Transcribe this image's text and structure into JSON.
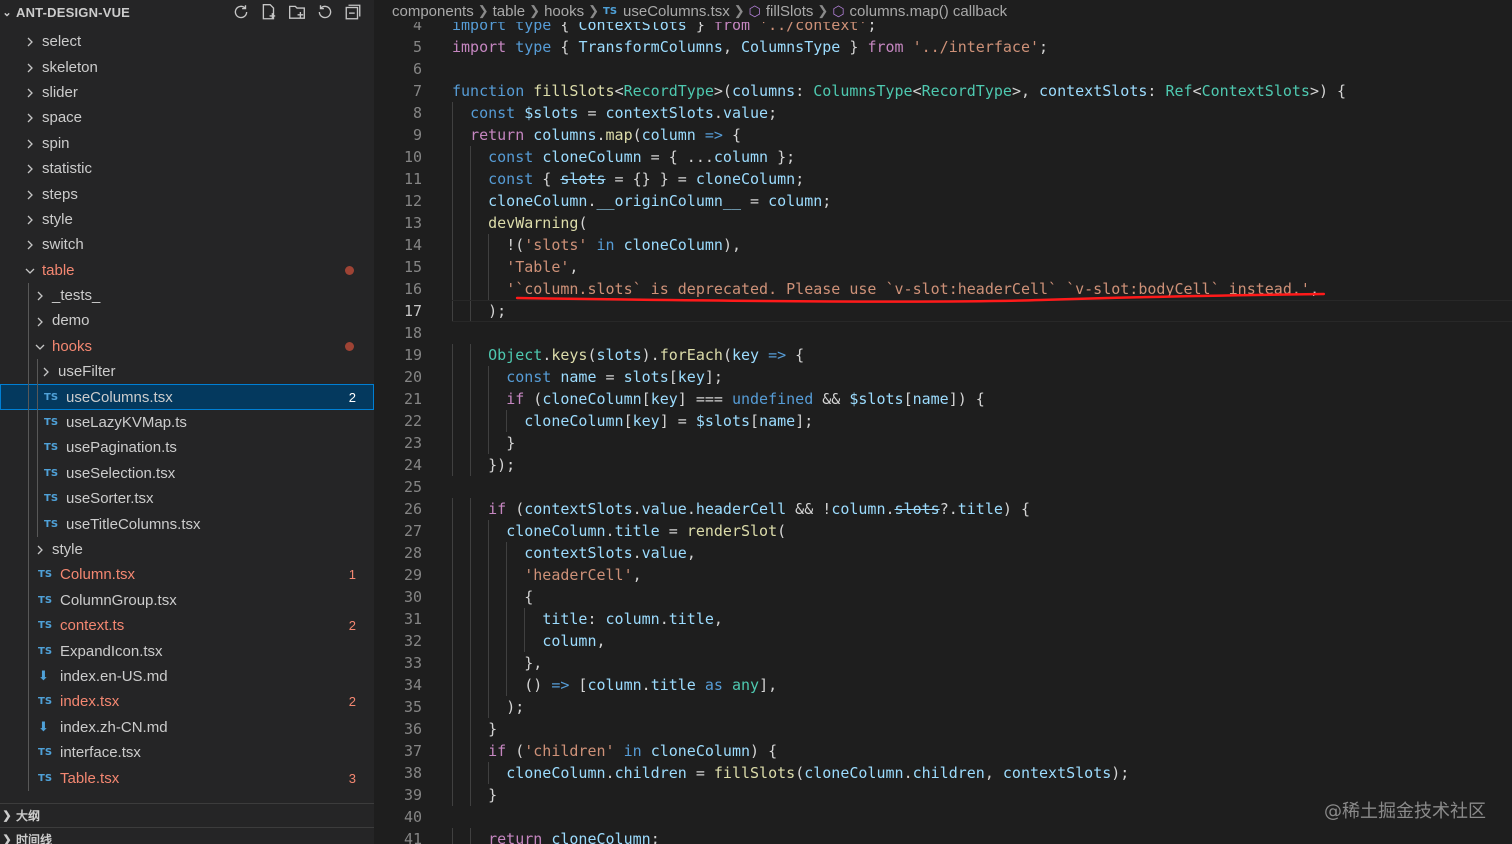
{
  "sidebar": {
    "title": "ANT-DESIGN-VUE",
    "actions": [
      "sync-icon",
      "new-file-icon",
      "new-folder-icon",
      "refresh-icon",
      "collapse-all-icon"
    ],
    "tree": [
      {
        "label": "select",
        "depth": 0,
        "kind": "folder",
        "open": false
      },
      {
        "label": "skeleton",
        "depth": 0,
        "kind": "folder",
        "open": false
      },
      {
        "label": "slider",
        "depth": 0,
        "kind": "folder",
        "open": false
      },
      {
        "label": "space",
        "depth": 0,
        "kind": "folder",
        "open": false
      },
      {
        "label": "spin",
        "depth": 0,
        "kind": "folder",
        "open": false
      },
      {
        "label": "statistic",
        "depth": 0,
        "kind": "folder",
        "open": false
      },
      {
        "label": "steps",
        "depth": 0,
        "kind": "folder",
        "open": false
      },
      {
        "label": "style",
        "depth": 0,
        "kind": "folder",
        "open": false
      },
      {
        "label": "switch",
        "depth": 0,
        "kind": "folder",
        "open": false
      },
      {
        "label": "table",
        "depth": 0,
        "kind": "folder",
        "open": true,
        "error": true,
        "dot": true
      },
      {
        "label": "_tests_",
        "depth": 1,
        "kind": "folder",
        "open": false
      },
      {
        "label": "demo",
        "depth": 1,
        "kind": "folder",
        "open": false
      },
      {
        "label": "hooks",
        "depth": 1,
        "kind": "folder",
        "open": true,
        "error": true,
        "dot": true
      },
      {
        "label": "useFilter",
        "depth": 2,
        "kind": "folder",
        "open": false
      },
      {
        "label": "useColumns.tsx",
        "depth": 2,
        "kind": "ts",
        "badge": "2",
        "selected": true
      },
      {
        "label": "useLazyKVMap.ts",
        "depth": 2,
        "kind": "ts"
      },
      {
        "label": "usePagination.ts",
        "depth": 2,
        "kind": "ts"
      },
      {
        "label": "useSelection.tsx",
        "depth": 2,
        "kind": "ts"
      },
      {
        "label": "useSorter.tsx",
        "depth": 2,
        "kind": "ts"
      },
      {
        "label": "useTitleColumns.tsx",
        "depth": 2,
        "kind": "ts"
      },
      {
        "label": "style",
        "depth": 1,
        "kind": "folder",
        "open": false
      },
      {
        "label": "Column.tsx",
        "depth": 1,
        "kind": "ts",
        "error": true,
        "badge": "1"
      },
      {
        "label": "ColumnGroup.tsx",
        "depth": 1,
        "kind": "ts"
      },
      {
        "label": "context.ts",
        "depth": 1,
        "kind": "ts",
        "error": true,
        "badge": "2"
      },
      {
        "label": "ExpandIcon.tsx",
        "depth": 1,
        "kind": "ts"
      },
      {
        "label": "index.en-US.md",
        "depth": 1,
        "kind": "md"
      },
      {
        "label": "index.tsx",
        "depth": 1,
        "kind": "ts",
        "error": true,
        "badge": "2"
      },
      {
        "label": "index.zh-CN.md",
        "depth": 1,
        "kind": "md"
      },
      {
        "label": "interface.tsx",
        "depth": 1,
        "kind": "ts"
      },
      {
        "label": "Table.tsx",
        "depth": 1,
        "kind": "ts",
        "error": true,
        "badge": "3"
      }
    ],
    "outline_label": "大纲",
    "timeline_label": "时间线"
  },
  "breadcrumb": {
    "items": [
      "components",
      "table",
      "hooks",
      "useColumns.tsx",
      "fillSlots",
      "columns.map() callback"
    ],
    "ts_marker": "TS"
  },
  "editor": {
    "current_line": 17,
    "squiggle_color": "#ff1a1a",
    "lines": [
      {
        "n": "4",
        "indent": 0,
        "tokens": [
          [
            "k",
            "import"
          ],
          [
            "p",
            " "
          ],
          [
            "k",
            "type"
          ],
          [
            "p",
            " { "
          ],
          [
            "v",
            "ContextSlots"
          ],
          [
            "p",
            " } "
          ],
          [
            "kc",
            "from"
          ],
          [
            "p",
            " "
          ],
          [
            "s",
            "'../context'"
          ],
          [
            "p",
            ";"
          ]
        ]
      },
      {
        "n": "5",
        "indent": 0,
        "tokens": [
          [
            "kc",
            "import"
          ],
          [
            "p",
            " "
          ],
          [
            "k",
            "type"
          ],
          [
            "p",
            " { "
          ],
          [
            "v",
            "TransformColumns"
          ],
          [
            "p",
            ", "
          ],
          [
            "v",
            "ColumnsType"
          ],
          [
            "p",
            " } "
          ],
          [
            "kc",
            "from"
          ],
          [
            "p",
            " "
          ],
          [
            "s",
            "'../interface'"
          ],
          [
            "p",
            ";"
          ]
        ]
      },
      {
        "n": "6",
        "indent": 0,
        "tokens": []
      },
      {
        "n": "7",
        "indent": 0,
        "tokens": [
          [
            "k",
            "function"
          ],
          [
            "p",
            " "
          ],
          [
            "f",
            "fillSlots"
          ],
          [
            "p",
            "<"
          ],
          [
            "t",
            "RecordType"
          ],
          [
            "p",
            ">("
          ],
          [
            "v",
            "columns"
          ],
          [
            "p",
            ": "
          ],
          [
            "t",
            "ColumnsType"
          ],
          [
            "p",
            "<"
          ],
          [
            "t",
            "RecordType"
          ],
          [
            "p",
            ">, "
          ],
          [
            "v",
            "contextSlots"
          ],
          [
            "p",
            ": "
          ],
          [
            "t",
            "Ref"
          ],
          [
            "p",
            "<"
          ],
          [
            "t",
            "ContextSlots"
          ],
          [
            "p",
            ">) {"
          ]
        ]
      },
      {
        "n": "8",
        "indent": 1,
        "tokens": [
          [
            "k",
            "const"
          ],
          [
            "p",
            " "
          ],
          [
            "v",
            "$slots"
          ],
          [
            "p",
            " = "
          ],
          [
            "v",
            "contextSlots"
          ],
          [
            "p",
            "."
          ],
          [
            "v",
            "value"
          ],
          [
            "p",
            ";"
          ]
        ]
      },
      {
        "n": "9",
        "indent": 1,
        "tokens": [
          [
            "kc",
            "return"
          ],
          [
            "p",
            " "
          ],
          [
            "v",
            "columns"
          ],
          [
            "p",
            "."
          ],
          [
            "f",
            "map"
          ],
          [
            "p",
            "("
          ],
          [
            "v",
            "column"
          ],
          [
            "p",
            " "
          ],
          [
            "k",
            "=>"
          ],
          [
            "p",
            " {"
          ]
        ]
      },
      {
        "n": "10",
        "indent": 2,
        "tokens": [
          [
            "k",
            "const"
          ],
          [
            "p",
            " "
          ],
          [
            "v",
            "cloneColumn"
          ],
          [
            "p",
            " = { ..."
          ],
          [
            "v",
            "column"
          ],
          [
            "p",
            " };"
          ]
        ]
      },
      {
        "n": "11",
        "indent": 2,
        "tokens": [
          [
            "k",
            "const"
          ],
          [
            "p",
            " { "
          ],
          [
            "v strike",
            "slots"
          ],
          [
            "p",
            " = {} } = "
          ],
          [
            "v",
            "cloneColumn"
          ],
          [
            "p",
            ";"
          ]
        ]
      },
      {
        "n": "12",
        "indent": 2,
        "tokens": [
          [
            "v",
            "cloneColumn"
          ],
          [
            "p",
            "."
          ],
          [
            "v",
            "__originColumn__"
          ],
          [
            "p",
            " = "
          ],
          [
            "v",
            "column"
          ],
          [
            "p",
            ";"
          ]
        ]
      },
      {
        "n": "13",
        "indent": 2,
        "tokens": [
          [
            "f",
            "devWarning"
          ],
          [
            "p",
            "("
          ]
        ]
      },
      {
        "n": "14",
        "indent": 3,
        "tokens": [
          [
            "p",
            "!("
          ],
          [
            "s",
            "'slots'"
          ],
          [
            "p",
            " "
          ],
          [
            "k",
            "in"
          ],
          [
            "p",
            " "
          ],
          [
            "v",
            "cloneColumn"
          ],
          [
            "p",
            "),"
          ]
        ]
      },
      {
        "n": "15",
        "indent": 3,
        "tokens": [
          [
            "s",
            "'Table'"
          ],
          [
            "p",
            ","
          ]
        ]
      },
      {
        "n": "16",
        "indent": 3,
        "tokens": [
          [
            "s",
            "'`column.slots` is deprecated. Please use `v-slot:headerCell` `v-slot:bodyCell` instead.'"
          ],
          [
            "p",
            ","
          ]
        ]
      },
      {
        "n": "17",
        "indent": 2,
        "tokens": [
          [
            "p",
            ");"
          ]
        ]
      },
      {
        "n": "18",
        "indent": 0,
        "tokens": []
      },
      {
        "n": "19",
        "indent": 2,
        "tokens": [
          [
            "t",
            "Object"
          ],
          [
            "p",
            "."
          ],
          [
            "f",
            "keys"
          ],
          [
            "p",
            "("
          ],
          [
            "v",
            "slots"
          ],
          [
            "p",
            ")."
          ],
          [
            "f",
            "forEach"
          ],
          [
            "p",
            "("
          ],
          [
            "v",
            "key"
          ],
          [
            "p",
            " "
          ],
          [
            "k",
            "=>"
          ],
          [
            "p",
            " {"
          ]
        ]
      },
      {
        "n": "20",
        "indent": 3,
        "tokens": [
          [
            "k",
            "const"
          ],
          [
            "p",
            " "
          ],
          [
            "v",
            "name"
          ],
          [
            "p",
            " = "
          ],
          [
            "v",
            "slots"
          ],
          [
            "p",
            "["
          ],
          [
            "v",
            "key"
          ],
          [
            "p",
            "];"
          ]
        ]
      },
      {
        "n": "21",
        "indent": 3,
        "tokens": [
          [
            "kc",
            "if"
          ],
          [
            "p",
            " ("
          ],
          [
            "v",
            "cloneColumn"
          ],
          [
            "p",
            "["
          ],
          [
            "v",
            "key"
          ],
          [
            "p",
            "] === "
          ],
          [
            "k",
            "undefined"
          ],
          [
            "p",
            " && "
          ],
          [
            "v",
            "$slots"
          ],
          [
            "p",
            "["
          ],
          [
            "v",
            "name"
          ],
          [
            "p",
            "]) {"
          ]
        ]
      },
      {
        "n": "22",
        "indent": 4,
        "tokens": [
          [
            "v",
            "cloneColumn"
          ],
          [
            "p",
            "["
          ],
          [
            "v",
            "key"
          ],
          [
            "p",
            "] = "
          ],
          [
            "v",
            "$slots"
          ],
          [
            "p",
            "["
          ],
          [
            "v",
            "name"
          ],
          [
            "p",
            "];"
          ]
        ]
      },
      {
        "n": "23",
        "indent": 3,
        "tokens": [
          [
            "p",
            "}"
          ]
        ]
      },
      {
        "n": "24",
        "indent": 2,
        "tokens": [
          [
            "p",
            "});"
          ]
        ]
      },
      {
        "n": "25",
        "indent": 0,
        "tokens": []
      },
      {
        "n": "26",
        "indent": 2,
        "tokens": [
          [
            "kc",
            "if"
          ],
          [
            "p",
            " ("
          ],
          [
            "v",
            "contextSlots"
          ],
          [
            "p",
            "."
          ],
          [
            "v",
            "value"
          ],
          [
            "p",
            "."
          ],
          [
            "v",
            "headerCell"
          ],
          [
            "p",
            " && !"
          ],
          [
            "v",
            "column"
          ],
          [
            "p",
            "."
          ],
          [
            "v strike",
            "slots"
          ],
          [
            "p",
            "?."
          ],
          [
            "v",
            "title"
          ],
          [
            "p",
            ") {"
          ]
        ]
      },
      {
        "n": "27",
        "indent": 3,
        "tokens": [
          [
            "v",
            "cloneColumn"
          ],
          [
            "p",
            "."
          ],
          [
            "v",
            "title"
          ],
          [
            "p",
            " = "
          ],
          [
            "f",
            "renderSlot"
          ],
          [
            "p",
            "("
          ]
        ]
      },
      {
        "n": "28",
        "indent": 4,
        "tokens": [
          [
            "v",
            "contextSlots"
          ],
          [
            "p",
            "."
          ],
          [
            "v",
            "value"
          ],
          [
            "p",
            ","
          ]
        ]
      },
      {
        "n": "29",
        "indent": 4,
        "tokens": [
          [
            "s",
            "'headerCell'"
          ],
          [
            "p",
            ","
          ]
        ]
      },
      {
        "n": "30",
        "indent": 4,
        "tokens": [
          [
            "p",
            "{"
          ]
        ]
      },
      {
        "n": "31",
        "indent": 5,
        "tokens": [
          [
            "v",
            "title"
          ],
          [
            "p",
            ": "
          ],
          [
            "v",
            "column"
          ],
          [
            "p",
            "."
          ],
          [
            "v",
            "title"
          ],
          [
            "p",
            ","
          ]
        ]
      },
      {
        "n": "32",
        "indent": 5,
        "tokens": [
          [
            "v",
            "column"
          ],
          [
            "p",
            ","
          ]
        ]
      },
      {
        "n": "33",
        "indent": 4,
        "tokens": [
          [
            "p",
            "},"
          ]
        ]
      },
      {
        "n": "34",
        "indent": 4,
        "tokens": [
          [
            "p",
            "() "
          ],
          [
            "k",
            "=>"
          ],
          [
            "p",
            " ["
          ],
          [
            "v",
            "column"
          ],
          [
            "p",
            "."
          ],
          [
            "v",
            "title"
          ],
          [
            "p",
            " "
          ],
          [
            "k",
            "as"
          ],
          [
            "p",
            " "
          ],
          [
            "t",
            "any"
          ],
          [
            "p",
            "],"
          ]
        ]
      },
      {
        "n": "35",
        "indent": 3,
        "tokens": [
          [
            "p",
            ");"
          ]
        ]
      },
      {
        "n": "36",
        "indent": 2,
        "tokens": [
          [
            "p",
            "}"
          ]
        ]
      },
      {
        "n": "37",
        "indent": 2,
        "tokens": [
          [
            "kc",
            "if"
          ],
          [
            "p",
            " ("
          ],
          [
            "s",
            "'children'"
          ],
          [
            "p",
            " "
          ],
          [
            "k",
            "in"
          ],
          [
            "p",
            " "
          ],
          [
            "v",
            "cloneColumn"
          ],
          [
            "p",
            ") {"
          ]
        ]
      },
      {
        "n": "38",
        "indent": 3,
        "tokens": [
          [
            "v",
            "cloneColumn"
          ],
          [
            "p",
            "."
          ],
          [
            "v",
            "children"
          ],
          [
            "p",
            " = "
          ],
          [
            "f",
            "fillSlots"
          ],
          [
            "p",
            "("
          ],
          [
            "v",
            "cloneColumn"
          ],
          [
            "p",
            "."
          ],
          [
            "v",
            "children"
          ],
          [
            "p",
            ", "
          ],
          [
            "v",
            "contextSlots"
          ],
          [
            "p",
            ");"
          ]
        ]
      },
      {
        "n": "39",
        "indent": 2,
        "tokens": [
          [
            "p",
            "}"
          ]
        ]
      },
      {
        "n": "40",
        "indent": 0,
        "tokens": []
      },
      {
        "n": "41",
        "indent": 2,
        "tokens": [
          [
            "kc",
            "return"
          ],
          [
            "p",
            " "
          ],
          [
            "v",
            "cloneColumn"
          ],
          [
            "p",
            ";"
          ]
        ]
      }
    ]
  },
  "watermark": "@稀土掘金技术社区"
}
